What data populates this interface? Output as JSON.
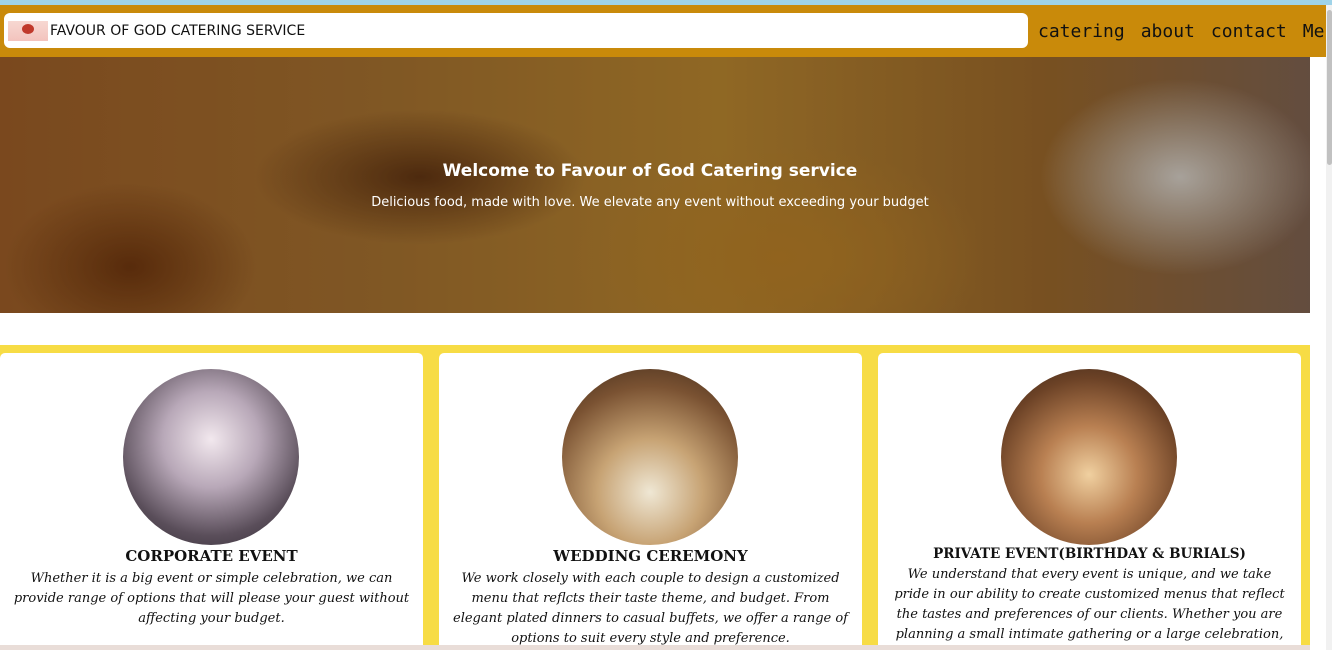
{
  "header": {
    "brand_name": "FAVOUR OF GOD CATERING SERVICE",
    "nav": [
      "catering",
      "about",
      "contact",
      "Menu"
    ]
  },
  "hero": {
    "title": "Welcome to Favour of God Catering service",
    "subtitle": "Delicious food, made with love. We elevate any event without exceeding your budget"
  },
  "cards": [
    {
      "title": "CORPORATE EVENT",
      "text": "Whether it is a big event or simple celebration, we can provide range of options that will please your guest without affecting your budget."
    },
    {
      "title": "WEDDING CEREMONY",
      "text": "We work closely with each couple to design a customized menu that reflcts their taste theme, and budget. From elegant plated dinners to casual buffets, we offer a range of options to suit every style and preference."
    },
    {
      "title": "PRIVATE EVENT(BIRTHDAY & BURIALS)",
      "text": "We understand that every event is unique, and we take pride in our ability to create customized menus that reflect the tastes and preferences of our clients. Whether you are planning a small intimate gathering or a large celebration,"
    }
  ],
  "colors": {
    "header": "#c98a0a",
    "cards_background": "#f7dc45"
  }
}
